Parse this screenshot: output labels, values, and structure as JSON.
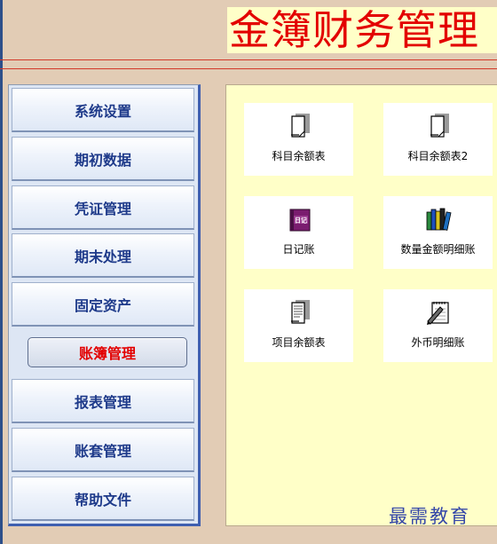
{
  "header": {
    "title": "金簿财务管理"
  },
  "nav": {
    "items": [
      {
        "label": "系统设置",
        "active": false
      },
      {
        "label": "期初数据",
        "active": false
      },
      {
        "label": "凭证管理",
        "active": false
      },
      {
        "label": "期末处理",
        "active": false
      },
      {
        "label": "固定资产",
        "active": false
      },
      {
        "label": "账簿管理",
        "active": true
      },
      {
        "label": "报表管理",
        "active": false
      },
      {
        "label": "账套管理",
        "active": false
      },
      {
        "label": "帮助文件",
        "active": false
      }
    ]
  },
  "content": {
    "tiles": [
      {
        "label": "科目余额表",
        "icon": "document-icon"
      },
      {
        "label": "科目余额表2",
        "icon": "document-icon"
      },
      {
        "label": "日记账",
        "icon": "journal-book-icon"
      },
      {
        "label": "数量金额明细账",
        "icon": "books-icon"
      },
      {
        "label": "项目余额表",
        "icon": "lined-document-icon"
      },
      {
        "label": "外币明细账",
        "icon": "notepad-pen-icon"
      }
    ]
  },
  "watermark": "最需教育",
  "colors": {
    "title": "#e30000",
    "active_nav": "#e30000",
    "nav_text": "#1e3a8a",
    "content_bg": "#ffffc8"
  }
}
